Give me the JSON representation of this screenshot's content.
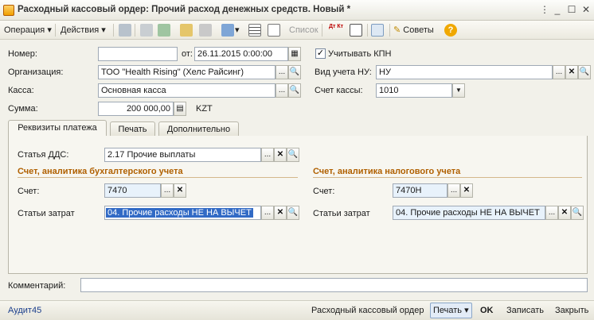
{
  "window": {
    "title": "Расходный кассовый ордер: Прочий расход денежных средств. Новый *",
    "menu_icon": "menu-dots-icon",
    "minimize": "_",
    "maximize": "☐",
    "close": "✕"
  },
  "toolbar": {
    "operation_label": "Операция",
    "actions_label": "Действия",
    "list_label": "Список",
    "tips_label": "Советы",
    "help_label": "?",
    "dt_kt": "Дт Кт"
  },
  "header": {
    "number_label": "Номер:",
    "number_value": "",
    "date_label": "от:",
    "date_value": "26.11.2015  0:00:00",
    "kpn_label": "Учитывать КПН",
    "kpn_checked": "✓",
    "org_label": "Организация:",
    "org_value": "ТОО \"Health Rising\" (Хелс Райсинг)",
    "nu_label": "Вид учета НУ:",
    "nu_value": "НУ",
    "cash_label": "Касса:",
    "cash_value": "Основная касса",
    "account_label": "Счет кассы:",
    "account_value": "1010",
    "sum_label": "Сумма:",
    "sum_value": "200 000,00",
    "currency": "KZT"
  },
  "tabs": [
    {
      "label": "Реквизиты платежа"
    },
    {
      "label": "Печать"
    },
    {
      "label": "Дополнительно"
    }
  ],
  "payment": {
    "dds_label": "Статья ДДС:",
    "dds_value": "2.17 Прочие выплаты",
    "acc_section": "Счет, аналитика бухгалтерского учета",
    "tax_section": "Счет, аналитика налогового учета",
    "acc_account_label": "Счет:",
    "acc_account_value": "7470",
    "acc_cost_label": "Статьи затрат",
    "acc_cost_value": "04. Прочие расходы НЕ НА ВЫЧЕТ",
    "tax_account_label": "Счет:",
    "tax_account_value": "7470Н",
    "tax_cost_label": "Статьи затрат",
    "tax_cost_value": "04. Прочие расходы НЕ НА ВЫЧЕТ"
  },
  "comment": {
    "label": "Комментарий:",
    "value": ""
  },
  "footer": {
    "author": "Аудит45",
    "doc_name": "Расходный кассовый ордер",
    "print_label": "Печать",
    "ok_label": "OK",
    "save_label": "Записать",
    "close_label": "Закрыть"
  },
  "symbols": {
    "dots": "...",
    "cross": "✕",
    "search": "🔍",
    "dropdown": "▼",
    "calendar": "▦",
    "calc": "▤",
    "arrow_down": "▾"
  }
}
